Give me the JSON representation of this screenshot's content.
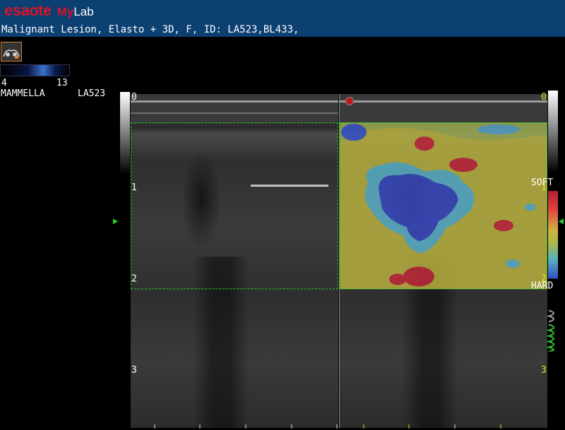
{
  "header": {
    "brand": "esaote",
    "product_prefix": "My",
    "product_suffix": "Lab",
    "title": "Malignant Lesion, Elasto + 3D, F, ID: LA523,BL433,",
    "bg_color": "#0c3f72"
  },
  "left_panel": {
    "probe_icon": "breast-probe-icon",
    "gain_min": "4",
    "gain_max": "13",
    "preset": "MAMMELLA",
    "study_id": "LA523"
  },
  "depth_scale": {
    "left": [
      "0",
      "1",
      "2",
      "3"
    ],
    "right": [
      "0",
      "1",
      "2",
      "3"
    ]
  },
  "elasto_scale": {
    "soft_label": "SOFT",
    "hard_label": "HARD",
    "colors": {
      "soft": "#b02030",
      "medium": "#d0b040",
      "hard": "#3050c8"
    }
  },
  "roi_color": "#27c927"
}
